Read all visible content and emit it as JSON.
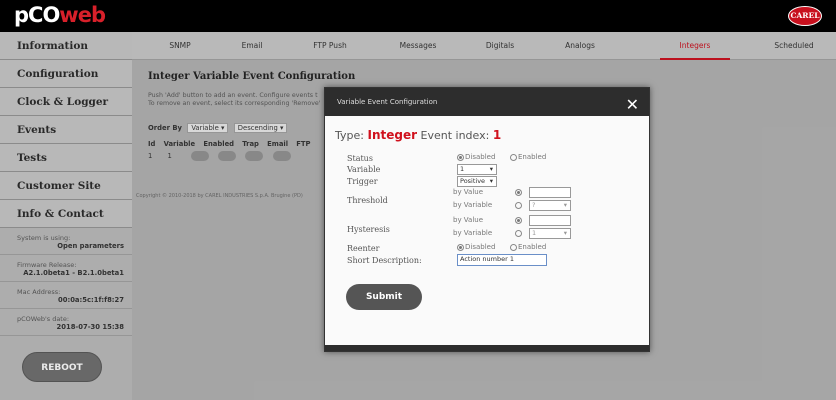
{
  "header": {
    "logo_part1": "pCO",
    "logo_part2": "web",
    "brand": "CAREL"
  },
  "sidebar": {
    "items": [
      {
        "label": "Information"
      },
      {
        "label": "Configuration"
      },
      {
        "label": "Clock & Logger"
      },
      {
        "label": "Events"
      },
      {
        "label": "Tests"
      },
      {
        "label": "Customer Site"
      },
      {
        "label": "Info & Contact"
      }
    ],
    "system_label": "System is using:",
    "system_value": "Open parameters",
    "firmware_label": "Firmware Release:",
    "firmware_value": "A2.1.0beta1 - B2.1.0beta1",
    "mac_label": "Mac Address:",
    "mac_value": "00:0a:5c:1f:f8:27",
    "date_label": "pCOWeb's date:",
    "date_value": "2018-07-30 15:38",
    "reboot_label": "REBOOT"
  },
  "tabs": [
    "SNMP",
    "Email",
    "FTP Push",
    "Messages",
    "Digitals",
    "Analogs",
    "Integers",
    "Scheduled"
  ],
  "active_tab": "Integers",
  "main": {
    "title": "Integer Variable Event Configuration",
    "desc1": "Push 'Add' button to add an event. Configure events t",
    "desc2": "To remove an event, select its corresponding 'Remove'",
    "order_label": "Order By",
    "order_field": "Variable",
    "order_dir": "Descending",
    "table_headers": [
      "Id",
      "Variable",
      "Enabled",
      "Trap",
      "Email",
      "FTP"
    ],
    "table_row": [
      "1",
      "1"
    ],
    "copyright": "Copyright © 2010-2018 by CAREL INDUSTRIES S.p.A. Brugine (PD)"
  },
  "modal": {
    "header": "Variable Event Configuration",
    "close": "✕",
    "type_prefix": "Type:",
    "type_value": "Integer",
    "event_index_label": "Event index:",
    "event_index": "1",
    "status_label": "Status",
    "disabled": "Disabled",
    "enabled": "Enabled",
    "variable_label": "Variable",
    "variable_value": "1",
    "trigger_label": "Trigger",
    "trigger_value": "Positive",
    "threshold_label": "Threshold",
    "hysteresis_label": "Hysteresis",
    "by_value": "by Value",
    "by_variable": "by Variable",
    "threshold_var": "?",
    "hysteresis_var": "1",
    "reenter_label": "Reenter",
    "short_desc_label": "Short Description:",
    "short_desc_value": "Action number 1",
    "submit": "Submit"
  }
}
